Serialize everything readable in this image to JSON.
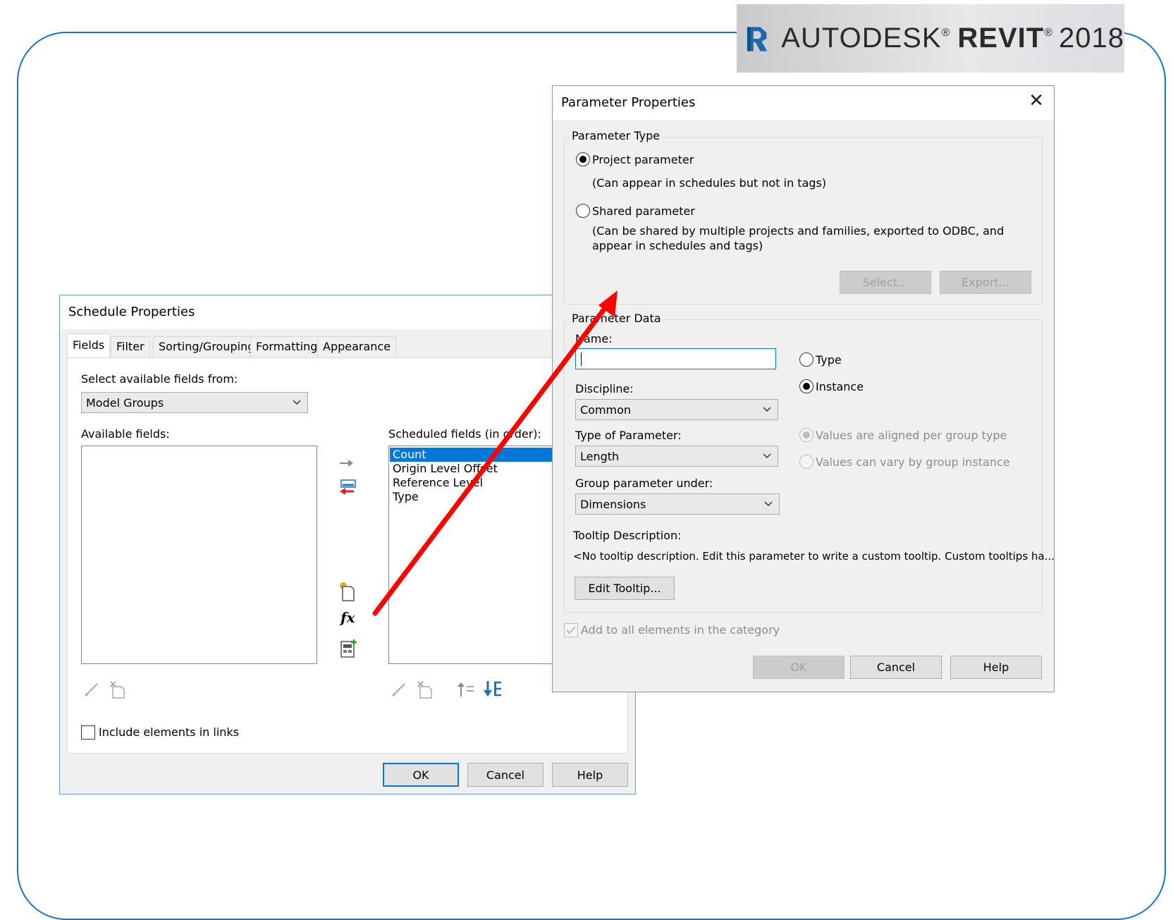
{
  "logo": {
    "brand": "AUTODESK",
    "product": "REVIT",
    "year": "2018"
  },
  "schedule_dialog": {
    "title": "Schedule Properties",
    "tabs": [
      {
        "label": "Fields"
      },
      {
        "label": "Filter"
      },
      {
        "label": "Sorting/Grouping"
      },
      {
        "label": "Formatting"
      },
      {
        "label": "Appearance"
      }
    ],
    "select_fields_label": "Select available fields from:",
    "select_fields_value": "Model Groups",
    "available_fields_label": "Available fields:",
    "scheduled_fields_label": "Scheduled fields (in order):",
    "scheduled_fields": [
      "Count",
      "Origin Level Offset",
      "Reference Level",
      "Type"
    ],
    "include_links_label": "Include elements in links",
    "ok_label": "OK",
    "cancel_label": "Cancel",
    "help_label": "Help"
  },
  "param_dialog": {
    "title": "Parameter Properties",
    "type_group_label": "Parameter Type",
    "project_param_label": "Project parameter",
    "project_param_desc": "(Can appear in schedules but not in tags)",
    "shared_param_label": "Shared parameter",
    "shared_param_desc_1": "(Can be shared by multiple projects and families, exported to ODBC, and",
    "shared_param_desc_2": "appear in schedules and tags)",
    "select_label": "Select...",
    "export_label": "Export...",
    "data_group_label": "Parameter Data",
    "name_label": "Name:",
    "name_value": "",
    "discipline_label": "Discipline:",
    "discipline_value": "Common",
    "type_of_param_label": "Type of Parameter:",
    "type_of_param_value": "Length",
    "group_under_label": "Group parameter under:",
    "group_under_value": "Dimensions",
    "type_radio_label": "Type",
    "instance_radio_label": "Instance",
    "aligned_label": "Values are aligned per group type",
    "vary_label": "Values can vary by group instance",
    "tooltip_label": "Tooltip Description:",
    "tooltip_text": "<No tooltip description. Edit this parameter to write a custom tooltip. Custom tooltips ha...",
    "edit_tooltip_label": "Edit Tooltip...",
    "add_all_label": "Add to all elements in the category",
    "ok_label": "OK",
    "cancel_label": "Cancel",
    "help_label": "Help"
  },
  "colors": {
    "accent": "#0078d7",
    "frame": "#1b74c4",
    "arrow": "#ff0000",
    "selection": "#0078d7"
  }
}
